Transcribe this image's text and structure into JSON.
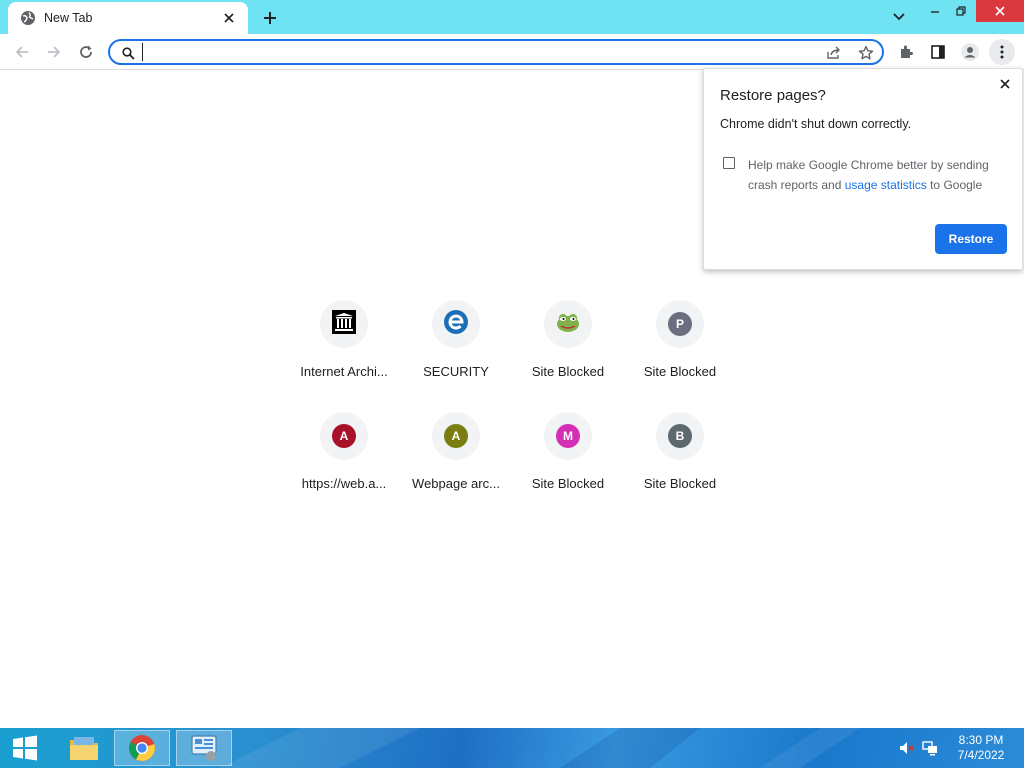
{
  "tab": {
    "title": "New Tab"
  },
  "omnibox": {
    "value": "",
    "placeholder": ""
  },
  "shortcuts": [
    {
      "label": "Internet Archi...",
      "icon": "internet-archive-icon"
    },
    {
      "label": "SECURITY",
      "icon": "ie-icon"
    },
    {
      "label": "Site Blocked",
      "icon": "frog-icon"
    },
    {
      "label": "Site Blocked",
      "letter": "P",
      "color": "#6a6e7f"
    },
    {
      "label": "https://web.a...",
      "letter": "A",
      "color": "#a8112a"
    },
    {
      "label": "Webpage arc...",
      "letter": "A",
      "color": "#7a7d10"
    },
    {
      "label": "Site Blocked",
      "letter": "M",
      "color": "#d42fb5"
    },
    {
      "label": "Site Blocked",
      "letter": "B",
      "color": "#5c6a70"
    }
  ],
  "popup": {
    "title": "Restore pages?",
    "message": "Chrome didn't shut down correctly.",
    "checkbox_text_1": "Help make Google Chrome better by sending crash reports and ",
    "checkbox_link": "usage statistics",
    "checkbox_text_2": " to Google",
    "checkbox_checked": false,
    "restore_label": "Restore"
  },
  "taskbar": {
    "time": "8:30 PM",
    "date": "7/4/2022"
  },
  "colors": {
    "titlebar": "#6fe3f2",
    "accent": "#1a73e8",
    "close": "#d9393e"
  }
}
